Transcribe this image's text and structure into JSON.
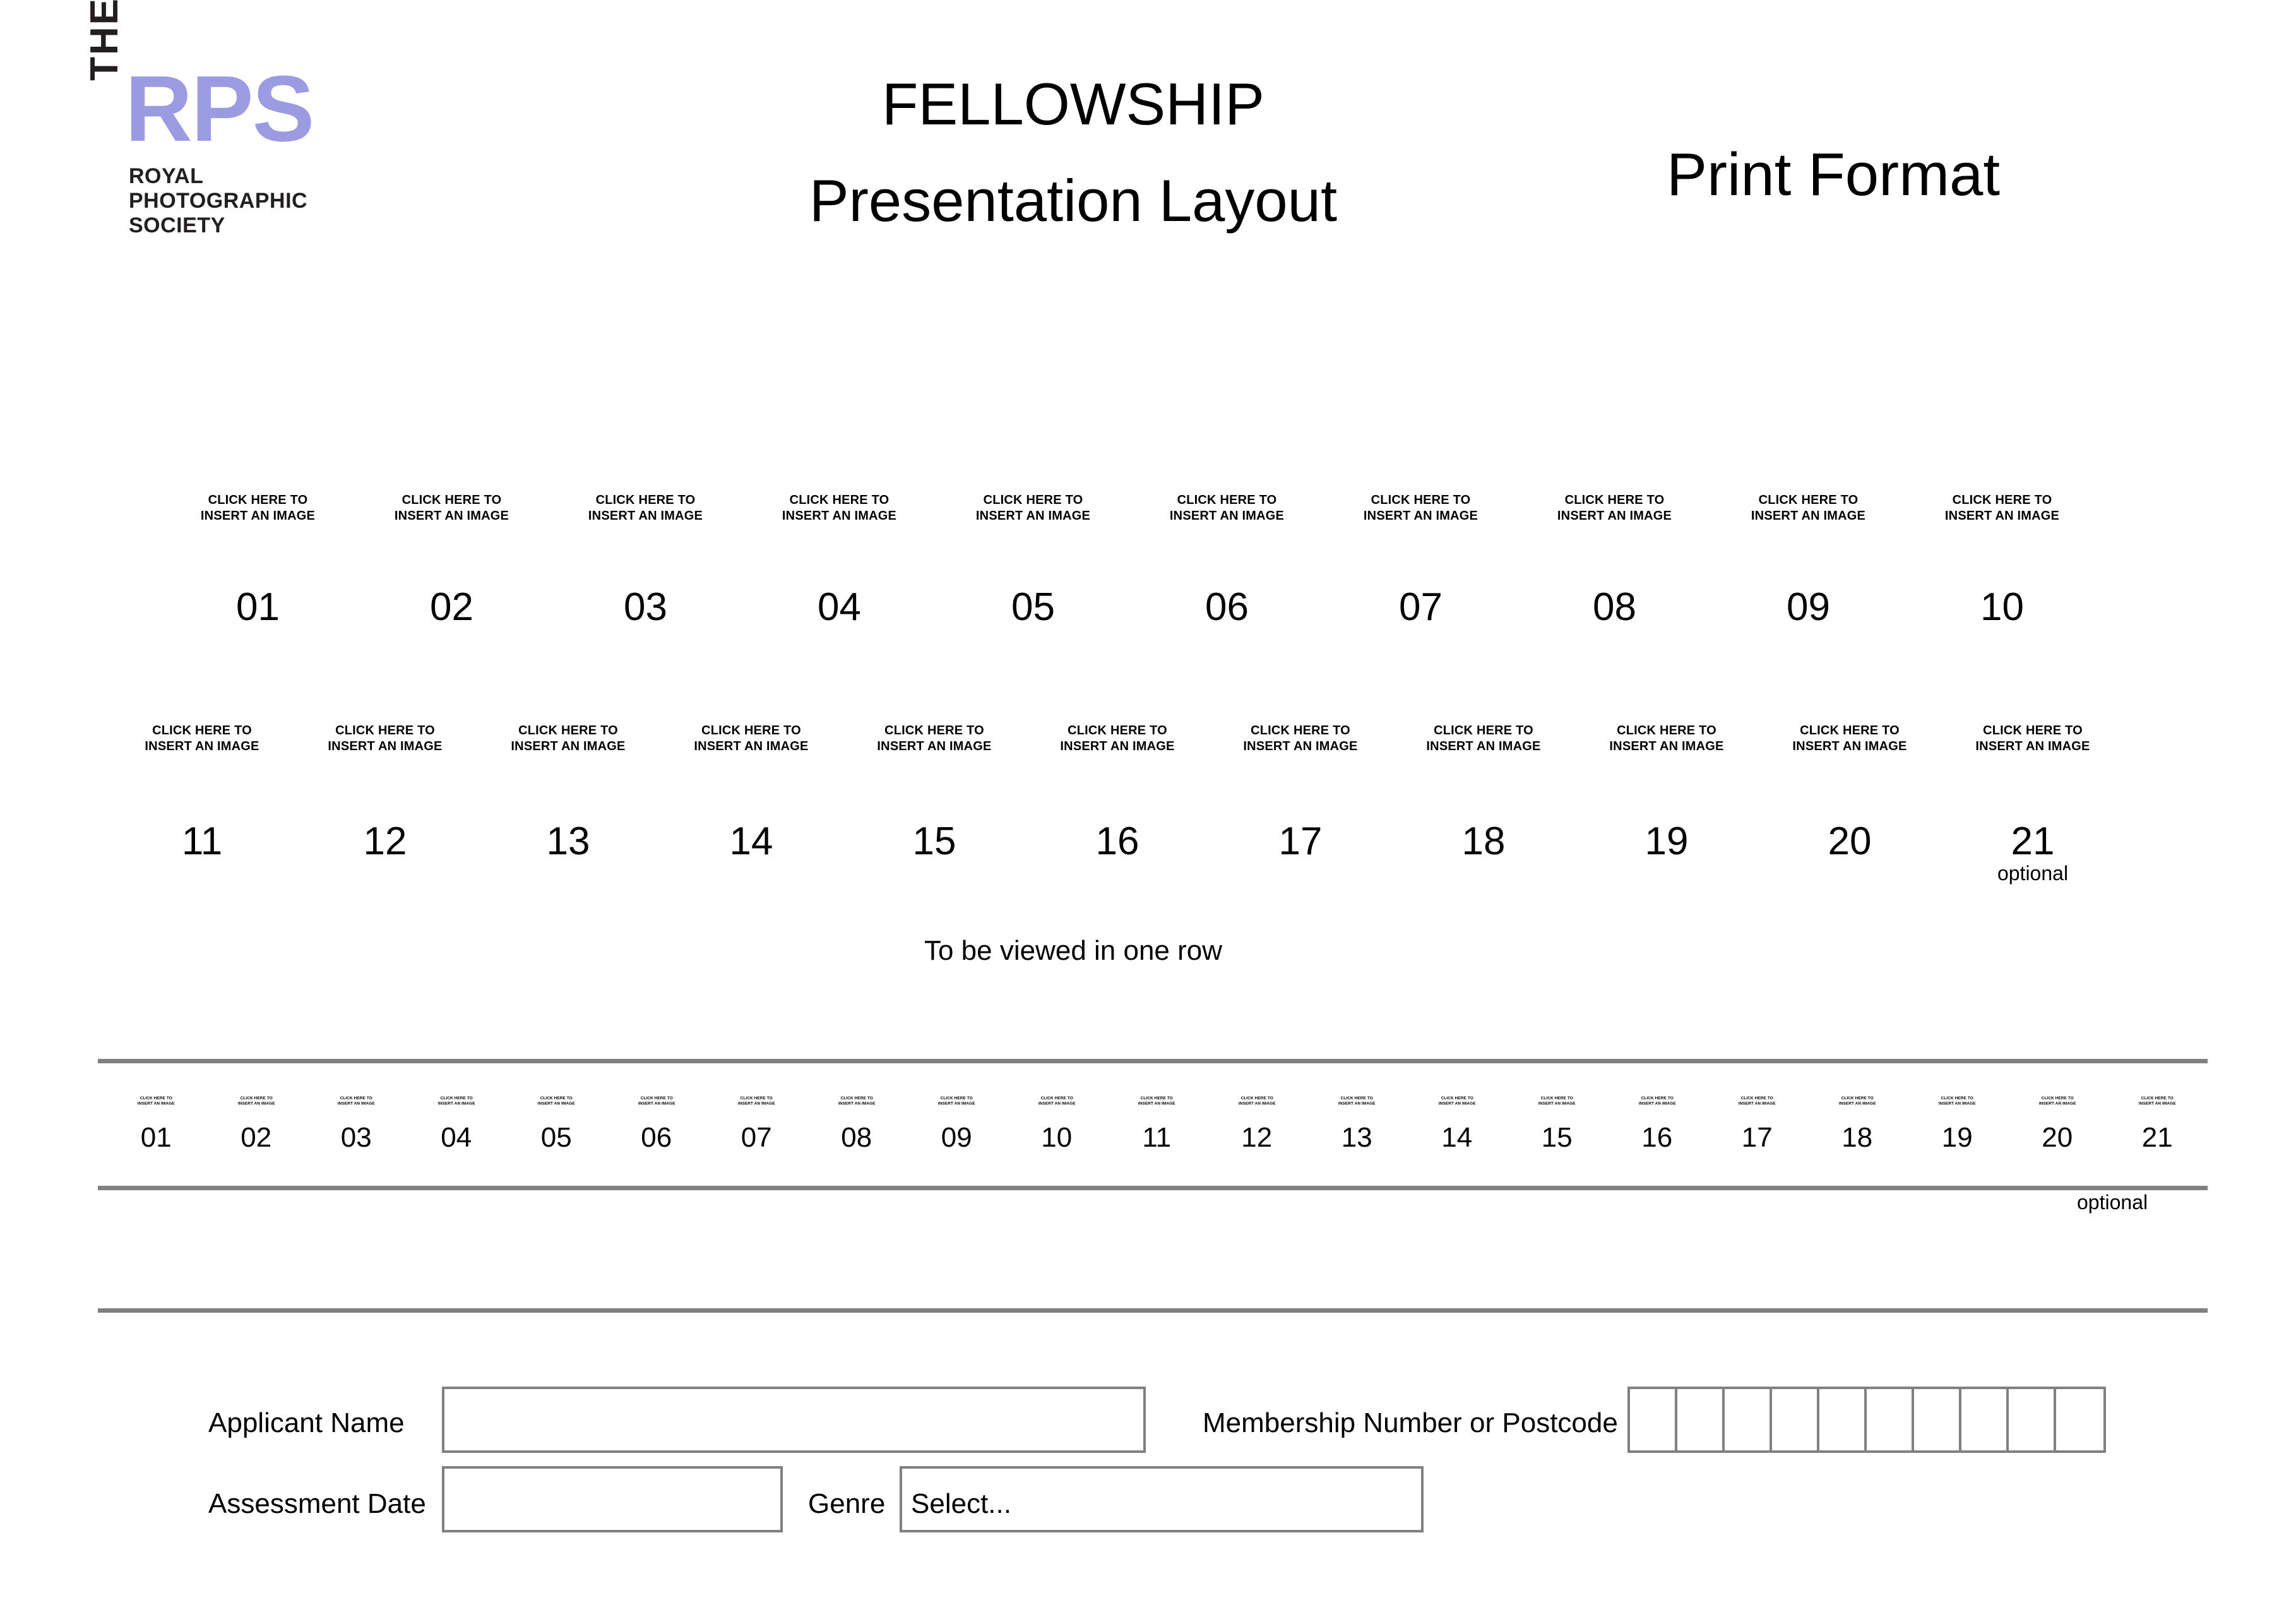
{
  "logo": {
    "the": "THE",
    "rps": "RPS",
    "subtitle_line1": "ROYAL",
    "subtitle_line2": "PHOTOGRAPHIC",
    "subtitle_line3": "SOCIETY",
    "accent_color": "#9b9be2"
  },
  "header": {
    "title": "FELLOWSHIP",
    "subtitle": "Presentation Layout",
    "format": "Print Format"
  },
  "placeholder": {
    "hint_line1": "CLICK HERE TO",
    "hint_line2": "INSERT AN IMAGE",
    "optional_label": "optional"
  },
  "row1": {
    "numbers": [
      "01",
      "02",
      "03",
      "04",
      "05",
      "06",
      "07",
      "08",
      "09",
      "10"
    ]
  },
  "row2": {
    "numbers": [
      "11",
      "12",
      "13",
      "14",
      "15",
      "16",
      "17",
      "18",
      "19",
      "20",
      "21"
    ],
    "optional_index": 10
  },
  "note": {
    "one_row": "To be viewed in one row"
  },
  "strip": {
    "numbers": [
      "01",
      "02",
      "03",
      "04",
      "05",
      "06",
      "07",
      "08",
      "09",
      "10",
      "11",
      "12",
      "13",
      "14",
      "15",
      "16",
      "17",
      "18",
      "19",
      "20",
      "21"
    ],
    "optional_label": "optional"
  },
  "form": {
    "applicant_name_label": "Applicant Name",
    "applicant_name_value": "",
    "membership_label": "Membership Number or Postcode",
    "membership_cells": [
      "",
      "",
      "",
      "",
      "",
      "",
      "",
      "",
      "",
      ""
    ],
    "assessment_date_label": "Assessment Date",
    "assessment_date_value": "",
    "genre_label": "Genre",
    "genre_value": "Select..."
  },
  "colors": {
    "rule": "#808080",
    "field_border": "#808080",
    "text": "#000000"
  }
}
